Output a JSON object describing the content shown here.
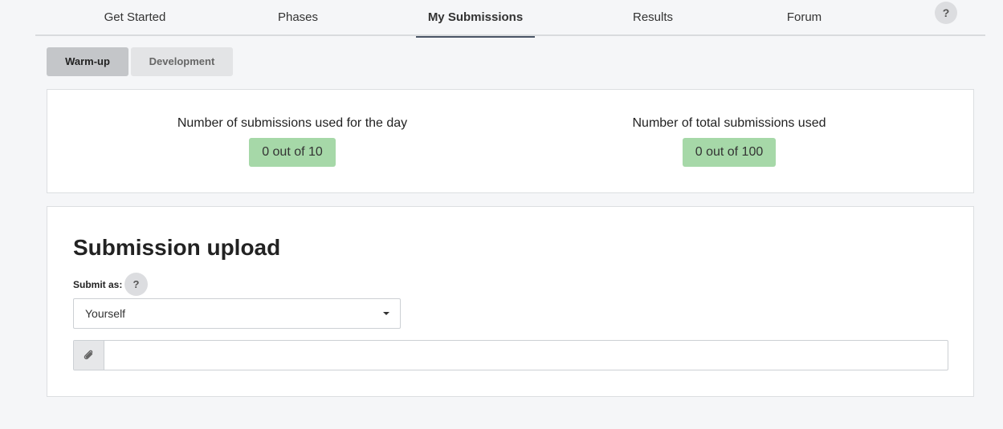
{
  "nav": {
    "items": [
      {
        "label": "Get Started",
        "active": false
      },
      {
        "label": "Phases",
        "active": false
      },
      {
        "label": "My Submissions",
        "active": true
      },
      {
        "label": "Results",
        "active": false
      },
      {
        "label": "Forum",
        "active": false
      }
    ],
    "help_label": "?"
  },
  "phase_tabs": [
    {
      "label": "Warm-up",
      "active": true
    },
    {
      "label": "Development",
      "active": false
    }
  ],
  "stats": {
    "daily": {
      "title": "Number of submissions used for the day",
      "value": "0 out of 10"
    },
    "total": {
      "title": "Number of total submissions used",
      "value": "0 out of 100"
    }
  },
  "upload": {
    "title": "Submission upload",
    "submit_as_label": "Submit as:",
    "help_label": "?",
    "submit_as_value": "Yourself",
    "file_value": ""
  },
  "icons": {
    "help": "question-mark-icon",
    "dropdown": "caret-down-icon",
    "attach": "paperclip-icon"
  },
  "colors": {
    "badge": "#a6d8a8",
    "active_tab": "#c4c6c9",
    "active_nav_underline": "#4a5566",
    "background": "#f5f6f8"
  }
}
